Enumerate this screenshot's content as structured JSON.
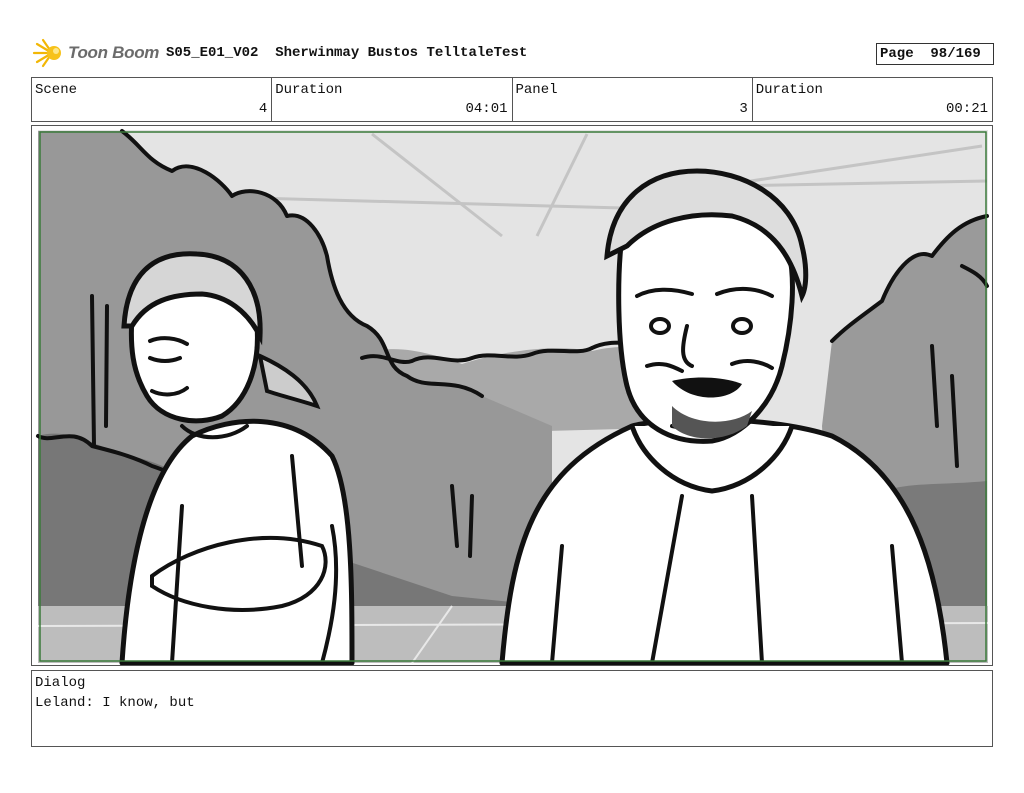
{
  "header": {
    "logo_text": "Toon Boom",
    "project_title": "S05_E01_V02  Sherwinmay Bustos TelltaleTest",
    "page_label": "Page  98/169"
  },
  "info": {
    "scene_label": "Scene",
    "scene_value": "4",
    "duration_label": "Duration",
    "duration_value": "04:01",
    "panel_label": "Panel",
    "panel_value": "3",
    "panel_duration_label": "Duration",
    "panel_duration_value": "00:21"
  },
  "panel": {
    "frame_color": "#3a7a3a"
  },
  "dialog": {
    "label": "Dialog",
    "text": "Leland: I know, but"
  }
}
